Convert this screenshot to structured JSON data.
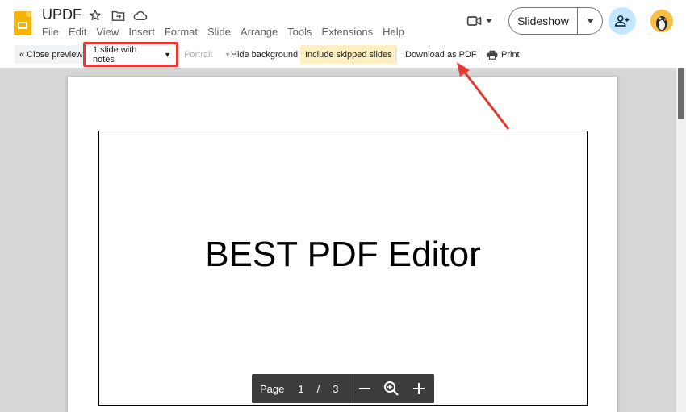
{
  "app": {
    "title": "UPDF",
    "menu": [
      "File",
      "Edit",
      "View",
      "Insert",
      "Format",
      "Slide",
      "Arrange",
      "Tools",
      "Extensions",
      "Help"
    ],
    "slideshow_label": "Slideshow"
  },
  "toolbar": {
    "close_preview": "« Close preview",
    "layout_selected": "1 slide with notes",
    "orientation": "Portrait",
    "hide_background": "Hide background",
    "include_skipped": "Include skipped slides",
    "download_pdf": "Download as PDF",
    "print": "Print"
  },
  "slide": {
    "text": "BEST PDF Editor"
  },
  "page_control": {
    "label": "Page",
    "current": "1",
    "separator": "/",
    "total": "3"
  },
  "colors": {
    "highlight_box": "#e53935",
    "skipped_bg": "#feefc3",
    "slides_logo": "#f4b400",
    "share_bg": "#c2e7ff"
  },
  "icons": [
    "slides-logo-icon",
    "star-icon",
    "move-folder-icon",
    "cloud-icon",
    "video-camera-icon",
    "chevron-down-icon",
    "add-person-icon",
    "avatar",
    "printer-icon",
    "minus-icon",
    "zoom-icon",
    "plus-icon"
  ]
}
